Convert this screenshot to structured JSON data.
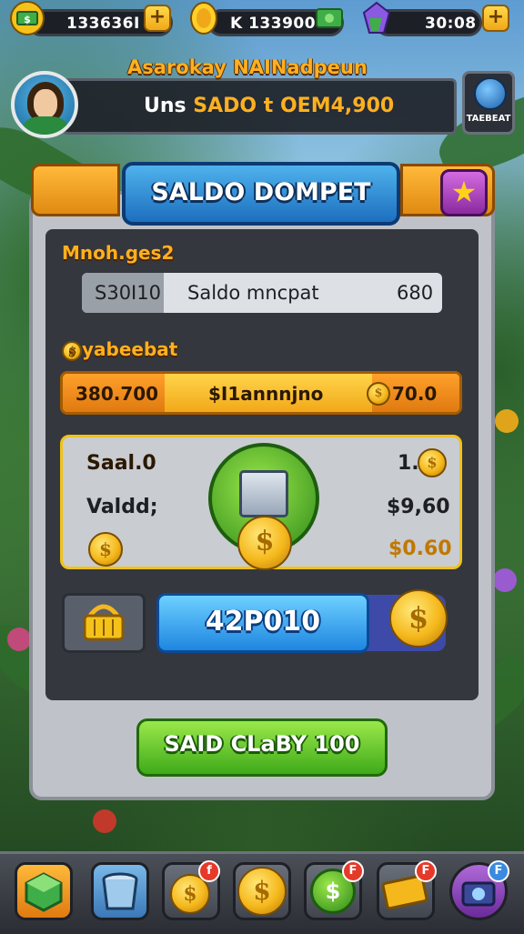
{
  "resources": {
    "cash": {
      "value": "133636I",
      "icon": "cash-stack-icon"
    },
    "coins": {
      "value": "K  133900",
      "icon": "gold-coin-icon"
    },
    "gems": {
      "value": "30:08",
      "icon": "gem-crystal-icon"
    },
    "plus": "+"
  },
  "profile": {
    "name": "Asarokay NAINadpeun",
    "line_prefix": "Uns",
    "line_highlight": "SADO t OEM4,900",
    "side_button_label": "TAEBEAT"
  },
  "panel": {
    "title": "SALDO DOMPET",
    "section1_label": "Mnoh.ges2",
    "row1": {
      "left": "S30I10",
      "middle": "Saldo mncpat",
      "right": "680"
    },
    "section2_label": "yabeebat",
    "row2": {
      "left": "380.700",
      "middle": "$I1annnjno",
      "right": "70.0"
    },
    "card": {
      "label1": "Saal.0",
      "label2": "Valdd;",
      "right1": "1.",
      "right2": "$9,60",
      "right3": "$0.60"
    },
    "blue_value": "42P010",
    "green_button": "SAID CLaBY 100"
  },
  "bottom_nav": {
    "badges": [
      "f",
      "F",
      "F",
      "F"
    ]
  },
  "colors": {
    "accent_gold": "#ffb020",
    "title_blue": "#1d6fbf",
    "button_green": "#3faa1a",
    "badge_red": "#e53a2a"
  }
}
